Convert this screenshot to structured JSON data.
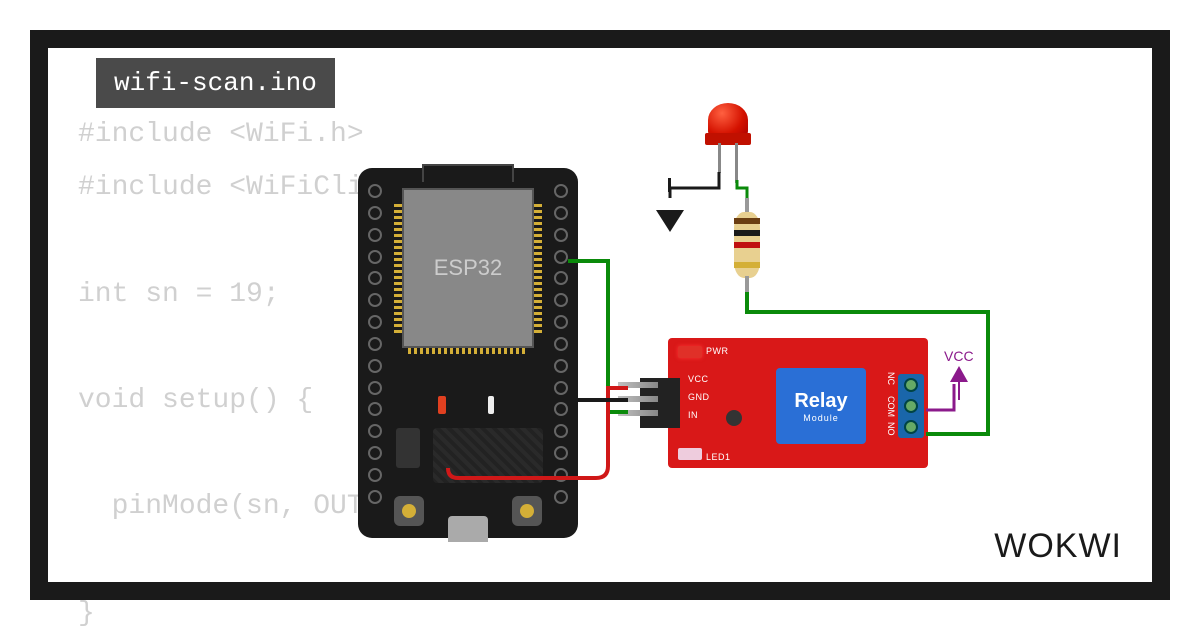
{
  "tab": {
    "filename": "wifi-scan.ino"
  },
  "code": {
    "lines": [
      "#include <WiFi.h>",
      "#include <WiFiClient.h>",
      "",
      "int sn = 19;",
      "",
      "void setup() {",
      "",
      "  pinMode(sn, OUT",
      "",
      "}"
    ]
  },
  "components": {
    "esp32": {
      "label": "ESP32"
    },
    "relay": {
      "title": "Relay",
      "subtitle": "Module",
      "pin_labels": {
        "pwr": "PWR",
        "vcc": "VCC",
        "gnd": "GND",
        "in": "IN",
        "led1": "LED1",
        "no": "NO",
        "com": "COM",
        "nc": "NC"
      }
    },
    "led": {
      "color": "#d41200"
    },
    "resistor": {
      "bands": [
        "#6b3e12",
        "#1a1a1a",
        "#c01010",
        "#d4af37"
      ]
    },
    "vcc": {
      "label": "VCC"
    }
  },
  "branding": {
    "logo_text": "WOKWI"
  }
}
